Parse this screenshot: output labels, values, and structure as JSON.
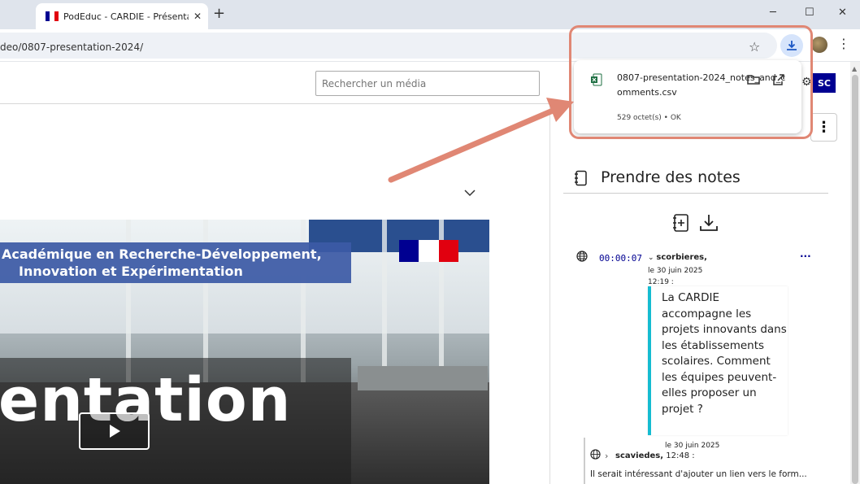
{
  "browser": {
    "tab_title": "PodEduc - CARDIE - Présentatio",
    "tab_close": "✕",
    "new_tab": "+",
    "minimize": "─",
    "maximize": "☐",
    "close": "✕",
    "url": "deo/0807-presentation-2024/"
  },
  "header": {
    "search_placeholder": "Rechercher un média",
    "user_initials": "SC"
  },
  "video": {
    "banner_line1": "Académique en Recherche-Développement,",
    "banner_line2": "Innovation et Expérimentation",
    "big_text": "entation"
  },
  "download": {
    "filename": "0807-presentation-2024_notes_and_comments.csv",
    "meta": "529 octet(s) • OK"
  },
  "notes": {
    "title": "Prendre des notes",
    "note1": {
      "timestamp": "00:00:07",
      "author": "scorbieres,",
      "date_line1": "le 30 juin 2025",
      "date_line2": "12:19 :",
      "text": "La CARDIE accompagne les projets innovants dans les établissements scolaires. Comment les équipes peuvent-elles proposer un projet ?",
      "more": "···"
    },
    "reply": {
      "date": "le 30 juin 2025",
      "author": "scaviedes,",
      "time": " 12:48 :",
      "text": "Il serait intéressant d'ajouter un lien vers le form..."
    }
  },
  "colors": {
    "accent": "#000091",
    "quote_border": "#15bcd1",
    "highlight": "#e08774"
  }
}
